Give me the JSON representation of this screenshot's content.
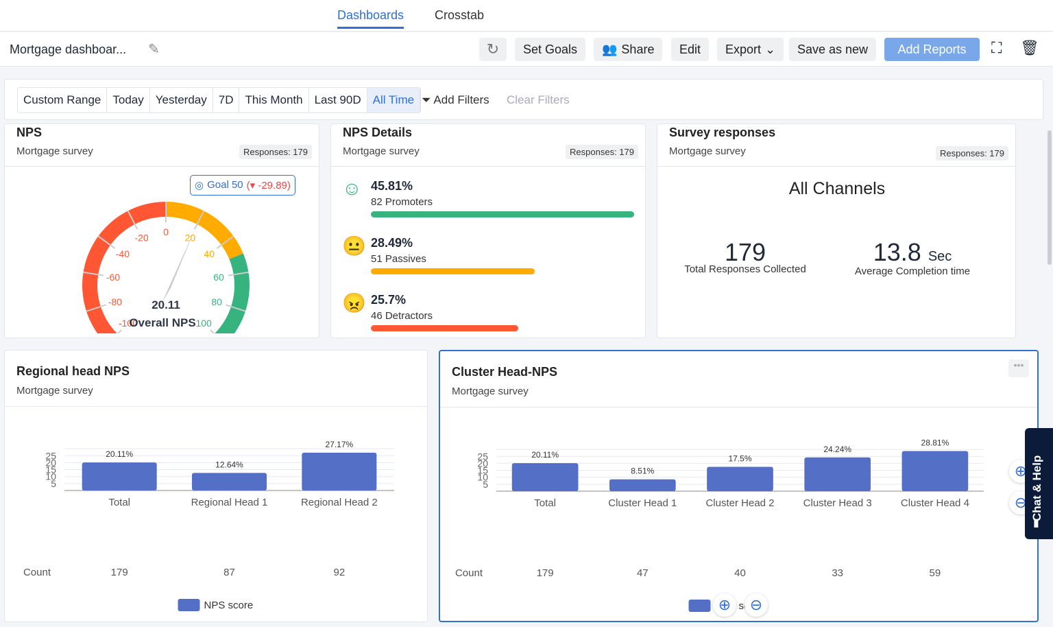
{
  "nav": {
    "tabs": [
      {
        "label": "Dashboards",
        "active": true
      },
      {
        "label": "Crosstab"
      }
    ]
  },
  "toolbar": {
    "title": "Mortgage dashboar...",
    "set_goals": "Set Goals",
    "share": "Share",
    "edit": "Edit",
    "export": "Export",
    "save_as_new": "Save as new",
    "add_reports": "Add Reports"
  },
  "filters": {
    "ranges": [
      "Custom Range",
      "Today",
      "Yesterday",
      "7D",
      "This Month",
      "Last 90D",
      "All Time"
    ],
    "selected": "All Time",
    "add_filters": "Add Filters",
    "clear_filters": "Clear Filters"
  },
  "nps": {
    "title": "NPS",
    "subtitle": "Mortgage survey",
    "responses": "Responses: 179",
    "goal_label": "Goal 50",
    "goal_delta": "-29.89",
    "value": "20.11",
    "value_num": 20.11,
    "label": "Overall NPS",
    "ticks": [
      "-100",
      "-80",
      "-60",
      "-40",
      "-20",
      "0",
      "20",
      "40",
      "60",
      "80",
      "100"
    ],
    "colors": {
      "detractor": "#ff5733",
      "passive": "#ffab00",
      "promoter": "#36b37e"
    }
  },
  "nps_details": {
    "title": "NPS Details",
    "subtitle": "Mortgage survey",
    "responses": "Responses: 179",
    "rows": [
      {
        "pct": "45.81%",
        "label": "82 Promoters",
        "value": 45.81,
        "color": "#36b37e",
        "icon": "smile-icon"
      },
      {
        "pct": "28.49%",
        "label": "51 Passives",
        "value": 28.49,
        "color": "#ffab00",
        "icon": "neutral-face-icon"
      },
      {
        "pct": "25.7%",
        "label": "46 Detractors",
        "value": 25.7,
        "color": "#ff5733",
        "icon": "angry-face-icon"
      }
    ]
  },
  "survey": {
    "title": "Survey responses",
    "subtitle": "Mortgage survey",
    "responses": "Responses: 179",
    "channel": "All Channels",
    "total": "179",
    "total_label": "Total Responses Collected",
    "avg": "13.8",
    "avg_unit": "Sec",
    "avg_label": "Average Completion time"
  },
  "chart_data": [
    {
      "type": "bar",
      "title": "Regional head NPS",
      "subtitle": "Mortgage survey",
      "categories": [
        "Total",
        "Regional Head 1",
        "Regional Head 2"
      ],
      "values": [
        20.11,
        12.64,
        27.17
      ],
      "labels": [
        "20.11%",
        "12.64%",
        "27.17%"
      ],
      "counts": [
        "179",
        "87",
        "92"
      ],
      "count_label": "Count",
      "legend": "NPS score",
      "yticks": [
        "5",
        "10",
        "15",
        "20",
        "25"
      ],
      "ylim": [
        0,
        30
      ],
      "color": "#5470c6",
      "grid": true,
      "legend_position": "bottom"
    },
    {
      "type": "bar",
      "title": "Cluster Head-NPS",
      "subtitle": "Mortgage survey",
      "categories": [
        "Cluster  Head 1",
        "Cluster  Head 2",
        "Cluster  Head 3",
        "Cluster  Head 4"
      ],
      "values": [
        20.11,
        8.51,
        17.5,
        24.24,
        28.81
      ],
      "labels": [
        "20.11%",
        "8.51%",
        "17.5%",
        "24.24%",
        "28.81%"
      ],
      "counts": [
        "179",
        "47",
        "40",
        "33",
        "59"
      ],
      "count_label": "Count",
      "legend": "NPS score",
      "yticks": [
        "5",
        "10",
        "15",
        "20",
        "25"
      ],
      "ylim": [
        0,
        30
      ],
      "color": "#5470c6",
      "grid": true,
      "legend_position": "bottom"
    }
  ],
  "chat": {
    "label": "Chat & Help"
  }
}
